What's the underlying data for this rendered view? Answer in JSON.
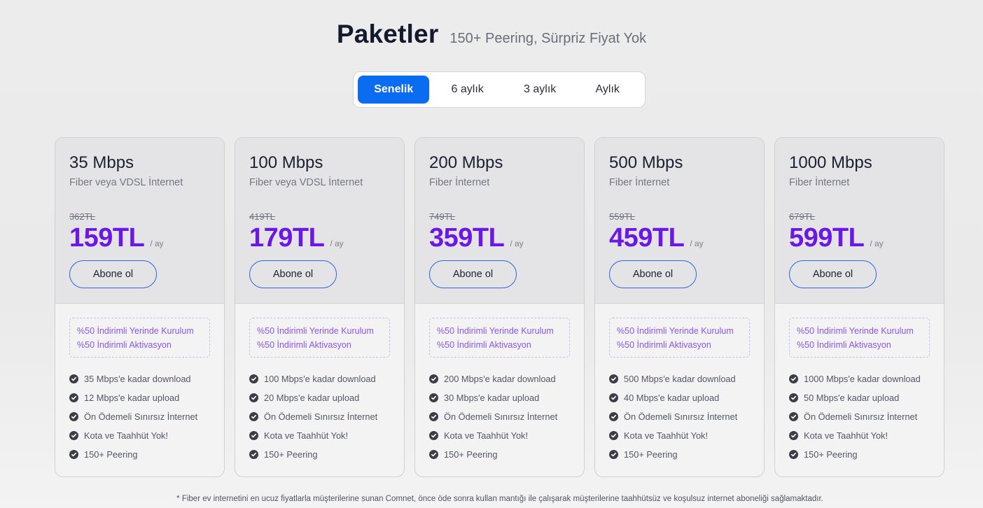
{
  "header": {
    "title": "Paketler",
    "subtitle": "150+ Peering, Sürpriz Fiyat Yok"
  },
  "period_tabs": [
    {
      "label": "Senelik",
      "active": true
    },
    {
      "label": "6 aylık",
      "active": false
    },
    {
      "label": "3 aylık",
      "active": false
    },
    {
      "label": "Aylık",
      "active": false
    }
  ],
  "plans": [
    {
      "speed": "35 Mbps",
      "tech": "Fiber veya VDSL İnternet",
      "old_price": "362TL",
      "price": "159TL",
      "period": "/ ay",
      "button": "Abone ol",
      "promo": [
        "%50 İndirimli Yerinde Kurulum",
        "%50 İndirimli Aktivasyon"
      ],
      "features": [
        "35 Mbps'e kadar download",
        "12 Mbps'e kadar upload",
        "Ön Ödemeli Sınırsız İnternet",
        "Kota ve Taahhüt Yok!",
        "150+ Peering"
      ]
    },
    {
      "speed": "100 Mbps",
      "tech": "Fiber veya VDSL İnternet",
      "old_price": "419TL",
      "price": "179TL",
      "period": "/ ay",
      "button": "Abone ol",
      "promo": [
        "%50 İndirimli Yerinde Kurulum",
        "%50 İndirimli Aktivasyon"
      ],
      "features": [
        "100 Mbps'e kadar download",
        "20 Mbps'e kadar upload",
        "Ön Ödemeli Sınırsız İnternet",
        "Kota ve Taahhüt Yok!",
        "150+ Peering"
      ]
    },
    {
      "speed": "200 Mbps",
      "tech": "Fiber İnternet",
      "old_price": "749TL",
      "price": "359TL",
      "period": "/ ay",
      "button": "Abone ol",
      "promo": [
        "%50 İndirimli Yerinde Kurulum",
        "%50 İndirimli Aktivasyon"
      ],
      "features": [
        "200 Mbps'e kadar download",
        "30 Mbps'e kadar upload",
        "Ön Ödemeli Sınırsız İnternet",
        "Kota ve Taahhüt Yok!",
        "150+ Peering"
      ]
    },
    {
      "speed": "500 Mbps",
      "tech": "Fiber İnternet",
      "old_price": "559TL",
      "price": "459TL",
      "period": "/ ay",
      "button": "Abone ol",
      "promo": [
        "%50 İndirimli Yerinde Kurulum",
        "%50 İndirimli Aktivasyon"
      ],
      "features": [
        "500 Mbps'e kadar download",
        "40 Mbps'e kadar upload",
        "Ön Ödemeli Sınırsız İnternet",
        "Kota ve Taahhüt Yok!",
        "150+ Peering"
      ]
    },
    {
      "speed": "1000 Mbps",
      "tech": "Fiber İnternet",
      "old_price": "679TL",
      "price": "599TL",
      "period": "/ ay",
      "button": "Abone ol",
      "promo": [
        "%50 İndirimli Yerinde Kurulum",
        "%50 İndirimli Aktivasyon"
      ],
      "features": [
        "1000 Mbps'e kadar download",
        "50 Mbps'e kadar upload",
        "Ön Ödemeli Sınırsız İnternet",
        "Kota ve Taahhüt Yok!",
        "150+ Peering"
      ]
    }
  ],
  "footnote": "* Fiber ev internetini en ucuz fiyatlarla müşterilerine sunan Comnet, önce öde sonra kullan mantığı ile çalışarak müşterilerine taahhütsüz ve koşulsuz internet aboneliği sağlamaktadır.",
  "colors": {
    "accent": "#0a6cf0",
    "price": "#6b17e6",
    "promo": "#8a55e8"
  },
  "icons": {
    "feature_bullet": "check-circle-icon"
  }
}
